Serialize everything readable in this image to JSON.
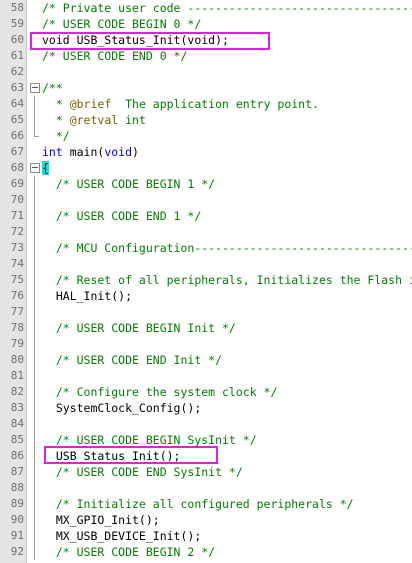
{
  "editor": {
    "lines": [
      {
        "num": "58",
        "segments": [
          {
            "cls": "cmt",
            "text": "/* Private user code ---------------------------------------------------------*/"
          }
        ]
      },
      {
        "num": "59",
        "segments": [
          {
            "cls": "cmt",
            "text": "/* USER CODE BEGIN 0 */"
          }
        ]
      },
      {
        "num": "60",
        "segments": [
          {
            "cls": "plain",
            "text": "void USB_Status_Init(void);"
          }
        ]
      },
      {
        "num": "61",
        "segments": [
          {
            "cls": "cmt",
            "text": "/* USER CODE END 0 */"
          }
        ]
      },
      {
        "num": "62",
        "segments": []
      },
      {
        "num": "63",
        "fold": "box",
        "segments": [
          {
            "cls": "doc",
            "text": "/**"
          }
        ]
      },
      {
        "num": "64",
        "fold": "line",
        "segments": [
          {
            "cls": "doc",
            "text": "  * "
          },
          {
            "cls": "tag",
            "text": "@brief"
          },
          {
            "cls": "doc",
            "text": "  The application entry point."
          }
        ]
      },
      {
        "num": "65",
        "fold": "line",
        "segments": [
          {
            "cls": "doc",
            "text": "  * "
          },
          {
            "cls": "tag",
            "text": "@retval"
          },
          {
            "cls": "doc",
            "text": " int"
          }
        ]
      },
      {
        "num": "66",
        "fold": "end",
        "segments": [
          {
            "cls": "doc",
            "text": "  */"
          }
        ]
      },
      {
        "num": "67",
        "segments": [
          {
            "cls": "kw",
            "text": "int"
          },
          {
            "cls": "plain",
            "text": " main("
          },
          {
            "cls": "kw",
            "text": "void"
          },
          {
            "cls": "plain",
            "text": ")"
          }
        ]
      },
      {
        "num": "68",
        "fold": "box",
        "segments": [
          {
            "cls": "brace-hl",
            "text": "{"
          }
        ]
      },
      {
        "num": "69",
        "fold": "line",
        "segments": [
          {
            "cls": "cmt",
            "text": "  /* USER CODE BEGIN 1 */"
          }
        ]
      },
      {
        "num": "70",
        "fold": "line",
        "segments": []
      },
      {
        "num": "71",
        "fold": "line",
        "segments": [
          {
            "cls": "cmt",
            "text": "  /* USER CODE END 1 */"
          }
        ]
      },
      {
        "num": "72",
        "fold": "line",
        "segments": []
      },
      {
        "num": "73",
        "fold": "line",
        "segments": [
          {
            "cls": "cmt",
            "text": "  /* MCU Configuration--------------------------------------------------------*/"
          }
        ]
      },
      {
        "num": "74",
        "fold": "line",
        "segments": []
      },
      {
        "num": "75",
        "fold": "line",
        "segments": [
          {
            "cls": "cmt",
            "text": "  /* Reset of all peripherals, Initializes the Flash interface and the Systick. */"
          }
        ]
      },
      {
        "num": "76",
        "fold": "line",
        "segments": [
          {
            "cls": "plain",
            "text": "  HAL_Init();"
          }
        ]
      },
      {
        "num": "77",
        "fold": "line",
        "segments": []
      },
      {
        "num": "78",
        "fold": "line",
        "segments": [
          {
            "cls": "cmt",
            "text": "  /* USER CODE BEGIN Init */"
          }
        ]
      },
      {
        "num": "79",
        "fold": "line",
        "segments": []
      },
      {
        "num": "80",
        "fold": "line",
        "segments": [
          {
            "cls": "cmt",
            "text": "  /* USER CODE END Init */"
          }
        ]
      },
      {
        "num": "81",
        "fold": "line",
        "segments": []
      },
      {
        "num": "82",
        "fold": "line",
        "segments": [
          {
            "cls": "cmt",
            "text": "  /* Configure the system clock */"
          }
        ]
      },
      {
        "num": "83",
        "fold": "line",
        "segments": [
          {
            "cls": "plain",
            "text": "  SystemClock_Config();"
          }
        ]
      },
      {
        "num": "84",
        "fold": "line",
        "segments": []
      },
      {
        "num": "85",
        "fold": "line",
        "segments": [
          {
            "cls": "cmt",
            "text": "  /* USER CODE BEGIN SysInit */"
          }
        ]
      },
      {
        "num": "86",
        "fold": "line",
        "segments": [
          {
            "cls": "plain",
            "text": "  USB_Status_Init();"
          }
        ]
      },
      {
        "num": "87",
        "fold": "line",
        "segments": [
          {
            "cls": "cmt",
            "text": "  /* USER CODE END SysInit */"
          }
        ]
      },
      {
        "num": "88",
        "fold": "line",
        "segments": []
      },
      {
        "num": "89",
        "fold": "line",
        "segments": [
          {
            "cls": "cmt",
            "text": "  /* Initialize all configured peripherals */"
          }
        ]
      },
      {
        "num": "90",
        "fold": "line",
        "segments": [
          {
            "cls": "plain",
            "text": "  MX_GPIO_Init();"
          }
        ]
      },
      {
        "num": "91",
        "fold": "line",
        "segments": [
          {
            "cls": "plain",
            "text": "  MX_USB_DEVICE_Init();"
          }
        ]
      },
      {
        "num": "92",
        "fold": "line",
        "segments": [
          {
            "cls": "cmt",
            "text": "  /* USER CODE BEGIN 2 */"
          }
        ]
      }
    ]
  },
  "colors": {
    "highlight_box": "#e020e0",
    "comment": "#007f00",
    "keyword": "#0000e6",
    "brace_match": "#00e6e6"
  }
}
